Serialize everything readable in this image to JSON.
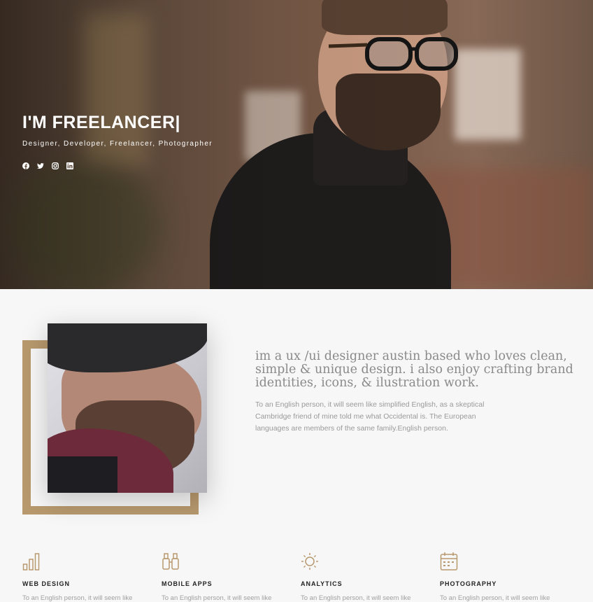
{
  "hero": {
    "title": "I'M FREELANCER|",
    "subtitle": "Designer, Developer, Freelancer, Photographer",
    "socials": [
      "facebook-icon",
      "twitter-icon",
      "instagram-icon",
      "linkedin-icon"
    ]
  },
  "about": {
    "heading": "im a ux /ui designer austin based who loves clean, simple & unique design. i also enjoy crafting brand identities, icons, & ilustration work.",
    "body": "To an English person, it will seem like simplified English, as a skeptical Cambridge friend of mine told me what Occidental is. The European languages are members of the same family.English person."
  },
  "services": [
    {
      "title": "WEB DESIGN",
      "text": "To an English person, it will seem like simplified English told me what",
      "icon": "bar-chart-icon"
    },
    {
      "title": "MOBILE APPS",
      "text": "To an English person, it will seem like simplified English told me what",
      "icon": "binoculars-icon"
    },
    {
      "title": "ANALYTICS",
      "text": "To an English person, it will seem like simplified English told me what",
      "icon": "sun-icon"
    },
    {
      "title": "PHOTOGRAPHY",
      "text": "To an English person, it will seem like simplified English told me what",
      "icon": "calendar-icon"
    }
  ],
  "colors": {
    "accent": "#b8996e",
    "background": "#f7f7f7"
  }
}
